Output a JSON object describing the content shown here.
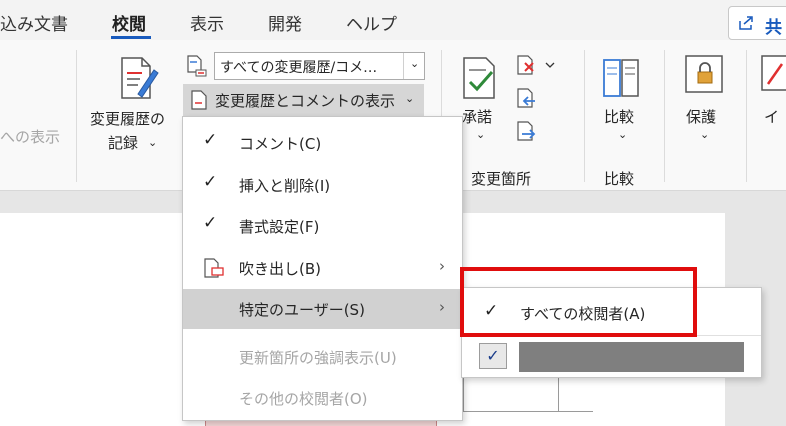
{
  "tabs": [
    "込み文書",
    "校閲",
    "表示",
    "開発",
    "ヘルプ"
  ],
  "share": {
    "label": "共",
    "icon": "share-icon"
  },
  "ribbon": {
    "left_greyed": "への表示",
    "track_changes": {
      "line1": "変更履歴の",
      "line2": "記録",
      "caret": "⌄"
    },
    "markup_dropdown": {
      "value": "すべての変更履歴/コメ…",
      "caret": "⌄"
    },
    "show_markup": {
      "label": "変更履歴とコメントの表示",
      "caret": "⌄"
    },
    "accept": {
      "label": "承諾",
      "caret": "⌄"
    },
    "changes_group_label": "変更箇所",
    "compare": {
      "label": "比較",
      "caret": "⌄",
      "group_label": "比較"
    },
    "protect": {
      "label": "保護",
      "caret": "⌄"
    },
    "ink": {
      "label": "イ"
    }
  },
  "menu": {
    "items": [
      {
        "label": "コメント(C)",
        "checked": true,
        "submenu": false,
        "disabled": false
      },
      {
        "label": "挿入と削除(I)",
        "checked": true,
        "submenu": false,
        "disabled": false
      },
      {
        "label": "書式設定(F)",
        "checked": true,
        "submenu": false,
        "disabled": false
      },
      {
        "label": "吹き出し(B)",
        "checked": false,
        "submenu": true,
        "disabled": false,
        "icon": "balloon-icon"
      },
      {
        "label": "特定のユーザー(S)",
        "checked": false,
        "submenu": true,
        "disabled": false,
        "highlighted": true
      },
      {
        "label": "更新箇所の強調表示(U)",
        "checked": false,
        "submenu": false,
        "disabled": true
      },
      {
        "label": "その他の校閲者(O)",
        "checked": false,
        "submenu": false,
        "disabled": true
      }
    ],
    "check_glyph": "✓",
    "arrow_glyph": "›"
  },
  "submenu": {
    "all_reviewers": {
      "label": "すべての校閲者(A)",
      "checked": true
    },
    "reviewer_checkbox": "✓"
  },
  "colors": {
    "accent": "#185abd",
    "highlight_red": "#e00d0d",
    "menu_hover": "#d1d1d1"
  }
}
